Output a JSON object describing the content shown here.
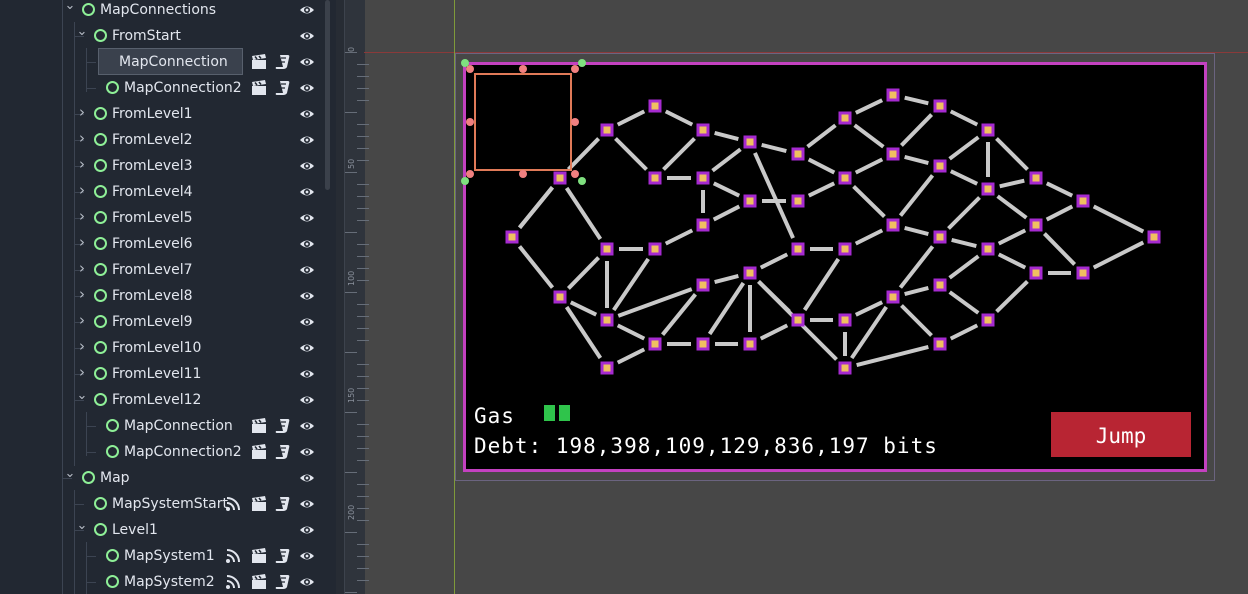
{
  "scene_tree": {
    "rows": [
      {
        "label": "MapConnections",
        "icons": [
          "eye-icon"
        ]
      },
      {
        "label": "FromStart",
        "icons": [
          "eye-icon"
        ]
      },
      {
        "label": "MapConnection",
        "icons": [
          "clapper-icon",
          "script-icon",
          "eye-icon"
        ]
      },
      {
        "label": "MapConnection2",
        "icons": [
          "clapper-icon",
          "script-icon",
          "eye-icon"
        ]
      },
      {
        "label": "FromLevel1",
        "icons": [
          "eye-icon"
        ]
      },
      {
        "label": "FromLevel2",
        "icons": [
          "eye-icon"
        ]
      },
      {
        "label": "FromLevel3",
        "icons": [
          "eye-icon"
        ]
      },
      {
        "label": "FromLevel4",
        "icons": [
          "eye-icon"
        ]
      },
      {
        "label": "FromLevel5",
        "icons": [
          "eye-icon"
        ]
      },
      {
        "label": "FromLevel6",
        "icons": [
          "eye-icon"
        ]
      },
      {
        "label": "FromLevel7",
        "icons": [
          "eye-icon"
        ]
      },
      {
        "label": "FromLevel8",
        "icons": [
          "eye-icon"
        ]
      },
      {
        "label": "FromLevel9",
        "icons": [
          "eye-icon"
        ]
      },
      {
        "label": "FromLevel10",
        "icons": [
          "eye-icon"
        ]
      },
      {
        "label": "FromLevel11",
        "icons": [
          "eye-icon"
        ]
      },
      {
        "label": "FromLevel12",
        "icons": [
          "eye-icon"
        ]
      },
      {
        "label": "MapConnection",
        "icons": [
          "clapper-icon",
          "script-icon",
          "eye-icon"
        ]
      },
      {
        "label": "MapConnection2",
        "icons": [
          "clapper-icon",
          "script-icon",
          "eye-icon"
        ]
      },
      {
        "label": "Map",
        "icons": [
          "eye-icon"
        ]
      },
      {
        "label": "MapSystemStart",
        "icons": [
          "signal-icon",
          "clapper-icon",
          "script-icon",
          "eye-icon"
        ]
      },
      {
        "label": "Level1",
        "icons": [
          "eye-icon"
        ]
      },
      {
        "label": "MapSystem1",
        "icons": [
          "signal-icon",
          "clapper-icon",
          "script-icon",
          "eye-icon"
        ]
      },
      {
        "label": "MapSystem2",
        "icons": [
          "signal-icon",
          "clapper-icon",
          "script-icon",
          "eye-icon"
        ]
      }
    ],
    "selected": "MapConnection"
  },
  "ruler": {
    "ticks": [
      "0",
      "50",
      "100",
      "150",
      "200"
    ]
  },
  "game": {
    "gas_label": "Gas",
    "gas_level": 2,
    "debt_text": "Debt: 198,398,109,129,836,197 bits",
    "jump_label": "Jump"
  },
  "colors": {
    "panel_bg": "#222832",
    "node_ring": "#8eef97",
    "game_border": "#c341c0",
    "jump_bg": "#b82533",
    "gas_fill": "#2fc44b",
    "system_fill": "#f0c060",
    "system_ring": "#a62ad0",
    "selection_box": "#e07a58"
  }
}
